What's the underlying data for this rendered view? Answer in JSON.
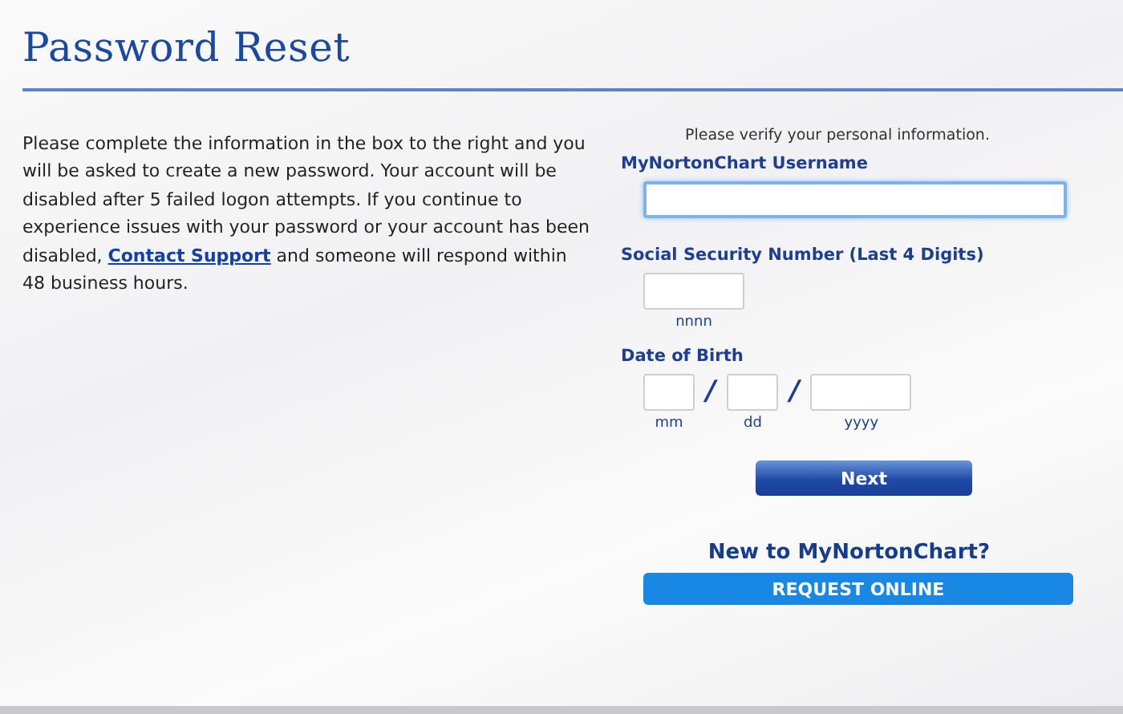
{
  "title": "Password Reset",
  "intro": {
    "before": "Please complete the information in the box to the right and you will be asked to create a new password. Your account will be disabled after 5 failed logon attempts. If you continue to experience issues with your password or your account has been disabled,",
    "link": "Contact Support",
    "after": "and someone will respond within 48 business hours."
  },
  "form": {
    "prompt": "Please verify your personal information.",
    "username": {
      "label": "MyNortonChart Username",
      "focused": true
    },
    "ssn": {
      "label": "Social Security Number (Last 4 Digits)",
      "hint": "nnnn"
    },
    "dob": {
      "label": "Date of Birth",
      "parts": [
        {
          "hint": "mm",
          "kind": "short"
        },
        {
          "hint": "dd",
          "kind": "short"
        },
        {
          "hint": "yyyy",
          "kind": "long"
        }
      ],
      "separators": [
        "/",
        "/"
      ]
    },
    "next_button": "Next"
  },
  "signup": {
    "heading": "New to MyNortonChart?",
    "button": "REQUEST ONLINE"
  }
}
